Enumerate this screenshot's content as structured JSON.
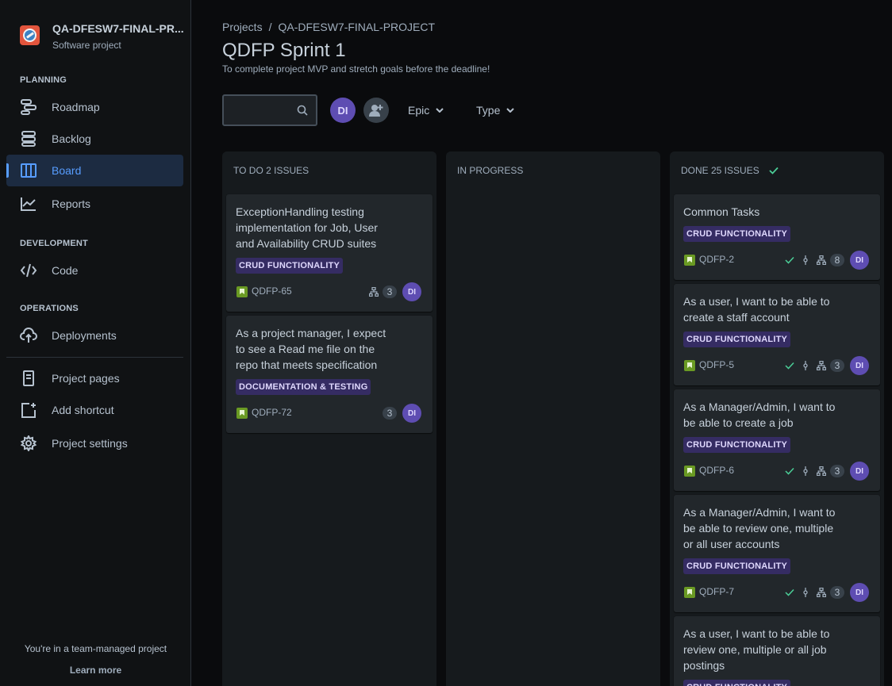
{
  "project": {
    "name": "QA-DFESW7-FINAL-PR...",
    "type": "Software project"
  },
  "sidebar": {
    "sections": {
      "planning": "PLANNING",
      "development": "DEVELOPMENT",
      "operations": "OPERATIONS"
    },
    "items": [
      {
        "label": "Roadmap",
        "icon": "roadmap-icon"
      },
      {
        "label": "Backlog",
        "icon": "backlog-icon"
      },
      {
        "label": "Board",
        "icon": "board-icon",
        "active": true
      },
      {
        "label": "Reports",
        "icon": "reports-icon"
      },
      {
        "label": "Code",
        "icon": "code-icon"
      },
      {
        "label": "Deployments",
        "icon": "cloud-upload-icon"
      },
      {
        "label": "Project pages",
        "icon": "page-icon"
      },
      {
        "label": "Add shortcut",
        "icon": "add-shortcut-icon"
      },
      {
        "label": "Project settings",
        "icon": "gear-icon"
      }
    ],
    "footer_text": "You're in a team-managed project",
    "footer_link": "Learn more"
  },
  "breadcrumb": {
    "projects": "Projects",
    "separator": "/",
    "current": "QA-DFESW7-FINAL-PROJECT"
  },
  "sprint": {
    "title": "QDFP Sprint 1",
    "goal": "To complete project MVP and stretch goals before the deadline!"
  },
  "toolbar": {
    "search_value": "",
    "avatar_initials": "DI",
    "filters": [
      "Epic",
      "Type"
    ]
  },
  "colors": {
    "accent": "#579dff",
    "avatar": "#5e4db2",
    "epic_bg": "#352c63",
    "story": "#6a9a23",
    "done_check": "#4bce97"
  },
  "columns": [
    {
      "title": "TO DO 2 ISSUES",
      "cards": [
        {
          "title": "ExceptionHandling testing implementation for Job, User and Availability CRUD suites",
          "epic": "CRUD FUNCTIONALITY",
          "key": "QDFP-65",
          "subtasks": "3",
          "assignee": "DI"
        },
        {
          "title": "As a project manager, I expect to see a Read me file on the repo that meets specification",
          "epic": "DOCUMENTATION & TESTING",
          "key": "QDFP-72",
          "subtasks": "3",
          "assignee": "DI"
        }
      ]
    },
    {
      "title": "IN PROGRESS",
      "cards": []
    },
    {
      "title": "DONE 25 ISSUES",
      "cards": [
        {
          "title": "Common Tasks",
          "epic": "CRUD FUNCTIONALITY",
          "key": "QDFP-2",
          "subtasks": "8",
          "assignee": "DI"
        },
        {
          "title": "As a user, I want to be able to create a staff account",
          "epic": "CRUD FUNCTIONALITY",
          "key": "QDFP-5",
          "subtasks": "3",
          "assignee": "DI"
        },
        {
          "title": "As a Manager/Admin, I want to be able to create a job",
          "epic": "CRUD FUNCTIONALITY",
          "key": "QDFP-6",
          "subtasks": "3",
          "assignee": "DI"
        },
        {
          "title": "As a Manager/Admin, I want to be able to review one, multiple or all user accounts",
          "epic": "CRUD FUNCTIONALITY",
          "key": "QDFP-7",
          "subtasks": "3",
          "assignee": "DI"
        },
        {
          "title": "As a user, I want to be able to review one, multiple or all job postings",
          "epic": "CRUD FUNCTIONALITY"
        }
      ]
    }
  ]
}
